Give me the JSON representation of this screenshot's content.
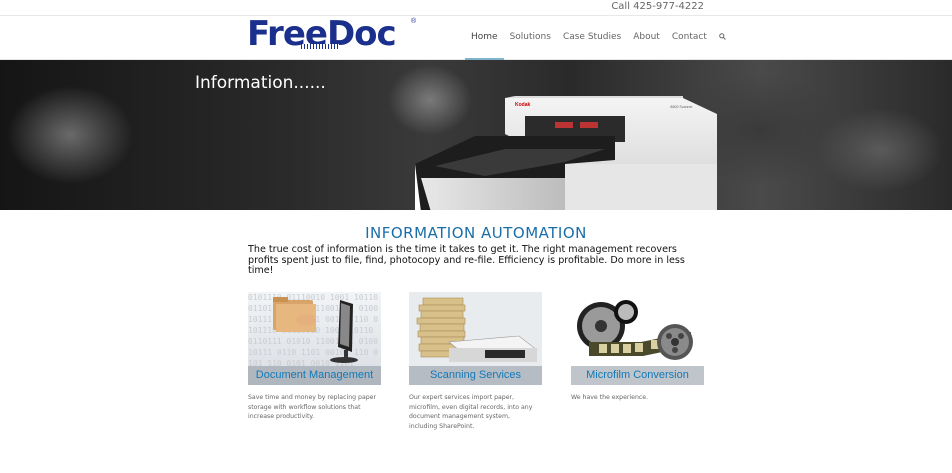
{
  "topbar": {
    "call": "Call 425-977-4222"
  },
  "logo": {
    "text": "FreeDoc",
    "reg": "®"
  },
  "nav": [
    {
      "label": "Home"
    },
    {
      "label": "Solutions"
    },
    {
      "label": "Case Studies"
    },
    {
      "label": "About"
    },
    {
      "label": "Contact"
    }
  ],
  "hero": {
    "title": "Information......",
    "scanner_brand": "Kodak",
    "scanner_model": "i5600 Scanner"
  },
  "section": {
    "title": "INFORMATION AUTOMATION",
    "text": "The true cost of information is the time it takes to get it. The right management recovers profits spent just to file, find, photocopy and re-file. Efficiency is profitable. Do more in less time!"
  },
  "cards": [
    {
      "label": "Document Management",
      "desc": "Save time and money by replacing paper storage with workflow solutions that increase productivity."
    },
    {
      "label": "Scanning Services",
      "desc": "Our expert services import paper, microfilm, even digital records, into any document management system, including SharePoint."
    },
    {
      "label": "Microfilm Conversion",
      "desc": "We have the experience."
    }
  ],
  "colors": {
    "brand": "#1b2f8c",
    "accent": "#1a6ea8",
    "card_label": "#1279b8"
  }
}
